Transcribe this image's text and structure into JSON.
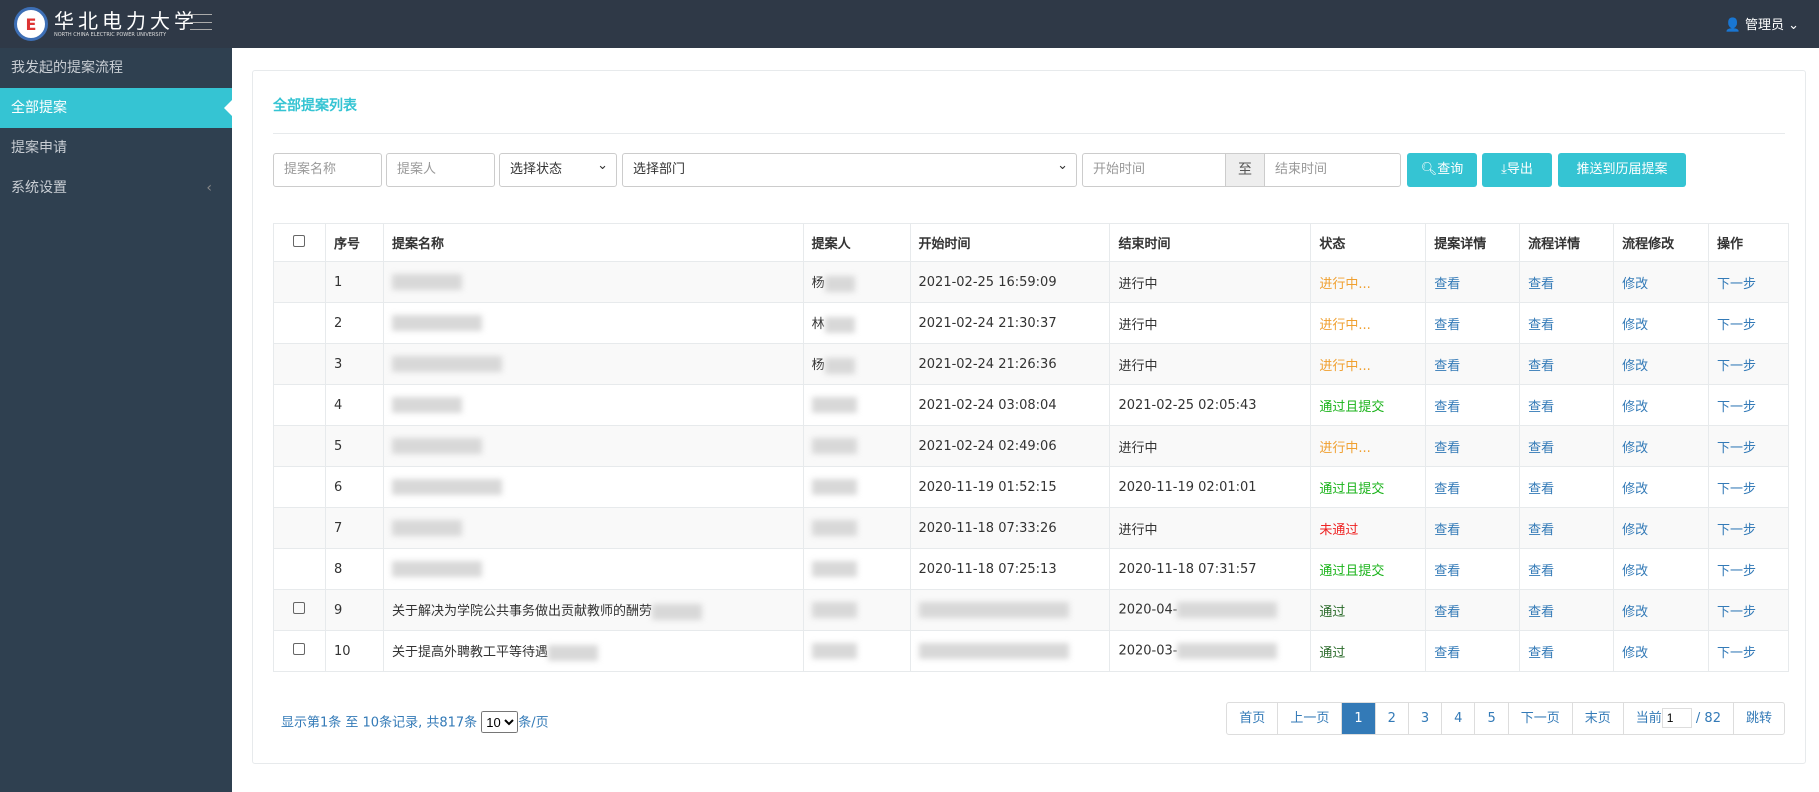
{
  "header": {
    "logo_text": "华北电力大学",
    "logo_sub": "NORTH CHINA ELECTRIC POWER UNIVERSITY",
    "user": "管理员"
  },
  "sidebar": {
    "items": [
      {
        "label": "我发起的提案流程"
      },
      {
        "label": "全部提案"
      },
      {
        "label": "提案申请"
      },
      {
        "label": "系统设置"
      }
    ]
  },
  "card": {
    "title": "全部提案列表"
  },
  "filters": {
    "name_placeholder": "提案名称",
    "person_placeholder": "提案人",
    "status_select": "选择状态",
    "dept_select": "选择部门",
    "start_placeholder": "开始时间",
    "to": "至",
    "end_placeholder": "结束时间",
    "search": "查询",
    "export": "导出",
    "push": "推送到历届提案"
  },
  "table": {
    "headers": [
      "序号",
      "提案名称",
      "提案人",
      "开始时间",
      "结束时间",
      "状态",
      "提案详情",
      "流程详情",
      "流程修改",
      "操作"
    ],
    "rows": [
      {
        "no": "1",
        "name": "",
        "person": "杨",
        "start": "2021-02-25 16:59:09",
        "end": "进行中",
        "status": "进行中...",
        "s": "orange",
        "cb": false
      },
      {
        "no": "2",
        "name": "",
        "person": "林",
        "start": "2021-02-24 21:30:37",
        "end": "进行中",
        "status": "进行中...",
        "s": "orange",
        "cb": false
      },
      {
        "no": "3",
        "name": "",
        "person": "杨",
        "start": "2021-02-24 21:26:36",
        "end": "进行中",
        "status": "进行中...",
        "s": "orange",
        "cb": false
      },
      {
        "no": "4",
        "name": "",
        "person": "",
        "start": "2021-02-24 03:08:04",
        "end": "2021-02-25 02:05:43",
        "status": "通过且提交",
        "s": "green",
        "cb": false
      },
      {
        "no": "5",
        "name": "",
        "person": "",
        "start": "2021-02-24 02:49:06",
        "end": "进行中",
        "status": "进行中...",
        "s": "orange",
        "cb": false
      },
      {
        "no": "6",
        "name": "",
        "person": "",
        "start": "2020-11-19 01:52:15",
        "end": "2020-11-19 02:01:01",
        "status": "通过且提交",
        "s": "green",
        "cb": false
      },
      {
        "no": "7",
        "name": "",
        "person": "",
        "start": "2020-11-18 07:33:26",
        "end": "进行中",
        "status": "未通过",
        "s": "red",
        "cb": false
      },
      {
        "no": "8",
        "name": "",
        "person": "",
        "start": "2020-11-18 07:25:13",
        "end": "2020-11-18 07:31:57",
        "status": "通过且提交",
        "s": "green",
        "cb": false
      },
      {
        "no": "9",
        "name": "关于解决为学院公共事务做出贡献教师的酬劳",
        "person": "",
        "start": "",
        "end": "2020-04-",
        "status": "通过",
        "s": "dark",
        "cb": true
      },
      {
        "no": "10",
        "name": "关于提高外聘教工平等待遇",
        "person": "",
        "start": "",
        "end": "2020-03-",
        "status": "通过",
        "s": "dark",
        "cb": true
      }
    ],
    "view": "查看",
    "modify": "修改",
    "next": "下一步"
  },
  "pagination": {
    "info_prefix": "显示第1条 至 10条记录, 共817条",
    "page_size": "10",
    "info_suffix": "条/页",
    "first": "首页",
    "prev": "上一页",
    "pages": [
      "1",
      "2",
      "3",
      "4",
      "5"
    ],
    "next": "下一页",
    "last": "末页",
    "current_label": "当前",
    "current": "1",
    "total": "/ 82",
    "jump": "跳转"
  }
}
